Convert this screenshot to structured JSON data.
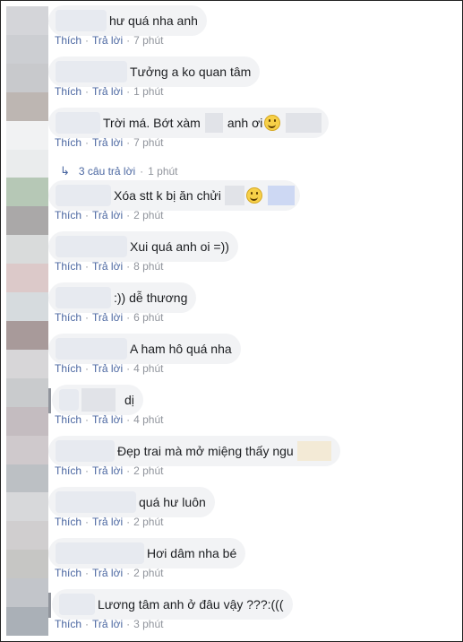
{
  "colors": {
    "bubble_bg": "#f2f3f5",
    "link": "#4b67a1",
    "meta": "#90949c",
    "text": "#1c1e21"
  },
  "avatars": [
    "#d4d5d9",
    "#ccced2",
    "#c8c9cc",
    "#bdb6b2",
    "#f1f2f3",
    "#eaeced",
    "#b6c8b6",
    "#aaa8a8",
    "#d9dbdb",
    "#dcc9c9",
    "#d6dbde",
    "#a89a9a",
    "#d7d6d8",
    "#c9cbcd",
    "#c4bcc0",
    "#cfc9cc",
    "#bcc0c4",
    "#d7d8da",
    "#d0cecf",
    "#c6c6c4",
    "#c2c5ca",
    "#aab0b7"
  ],
  "actions": {
    "like": "Thích",
    "reply": "Trả lời",
    "separator": "·"
  },
  "comments": [
    {
      "text": "hư quá nha anh",
      "time": "7 phút"
    },
    {
      "text": "Tưởng a ko quan tâm",
      "time": "1 phút"
    },
    {
      "text_a": "Trời má. Bớt xàm",
      "text_b": "anh ơi",
      "time": "7 phút"
    },
    {
      "text": "Xóa stt k bị ăn chửi",
      "time": "2 phút"
    },
    {
      "text": "Xui quá anh oi =))",
      "time": "8 phút"
    },
    {
      "text": ":)) dễ thương",
      "time": "6 phút"
    },
    {
      "text": "A ham hô quá nha",
      "time": "4 phút"
    },
    {
      "text": "dị",
      "time": "4 phút"
    },
    {
      "text": "Đẹp trai mà mở miệng thấy ngu",
      "time": "2 phút"
    },
    {
      "text": "quá hư luôn",
      "time": "2 phút"
    },
    {
      "text": "Hơi dâm nha bé",
      "time": "2 phút"
    },
    {
      "text": "Lương tâm anh ở đâu vậy ???:(((",
      "time": "3 phút"
    }
  ],
  "replies_link": {
    "icon": "reply-arrow-icon",
    "label": "3 câu trả lời",
    "time": "1 phút"
  }
}
